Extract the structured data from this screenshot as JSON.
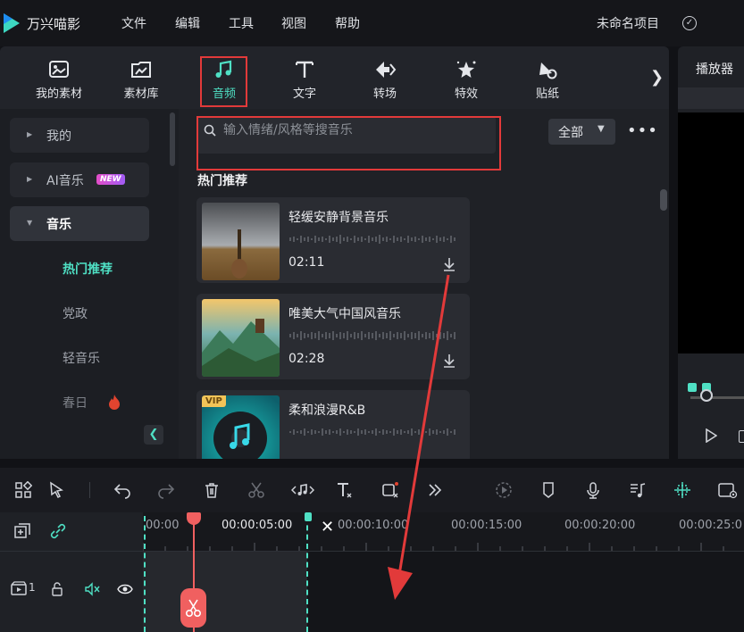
{
  "app": {
    "title": "万兴喵影",
    "project_name": "未命名项目"
  },
  "menu": [
    "文件",
    "编辑",
    "工具",
    "视图",
    "帮助"
  ],
  "tool_tabs": [
    {
      "label": "我的素材",
      "icon": "my-media-icon"
    },
    {
      "label": "素材库",
      "icon": "stock-media-icon"
    },
    {
      "label": "音频",
      "icon": "music-note-icon",
      "active": true
    },
    {
      "label": "文字",
      "icon": "text-icon"
    },
    {
      "label": "转场",
      "icon": "transition-icon"
    },
    {
      "label": "特效",
      "icon": "effects-icon"
    },
    {
      "label": "贴纸",
      "icon": "sticker-icon"
    }
  ],
  "sidebar": {
    "items": [
      {
        "label": "我的"
      },
      {
        "label": "AI音乐",
        "badge": "NEW"
      },
      {
        "label": "音乐",
        "expanded": true
      }
    ],
    "sub_items": [
      "热门推荐",
      "党政",
      "轻音乐",
      "春日"
    ]
  },
  "search": {
    "placeholder": "输入情绪/风格等搜音乐"
  },
  "filter": {
    "selected": "全部"
  },
  "section_title": "热门推荐",
  "tracks": [
    {
      "name": "轻缓安静背景音乐",
      "duration": "02:11"
    },
    {
      "name": "唯美大气中国风音乐",
      "duration": "02:28"
    },
    {
      "name": "柔和浪漫R&B",
      "duration": "",
      "badge": "VIP"
    }
  ],
  "player": {
    "title": "播放器"
  },
  "timeline": {
    "ticks": [
      "00:00",
      "00:00:05:00",
      "00:00:10:00",
      "00:00:15:00",
      "00:00:20:00",
      "00:00:25:0"
    ],
    "track_number": "1"
  },
  "colors": {
    "accent": "#4fe0c4",
    "highlight": "#e23a3a",
    "playhead": "#f06060"
  }
}
